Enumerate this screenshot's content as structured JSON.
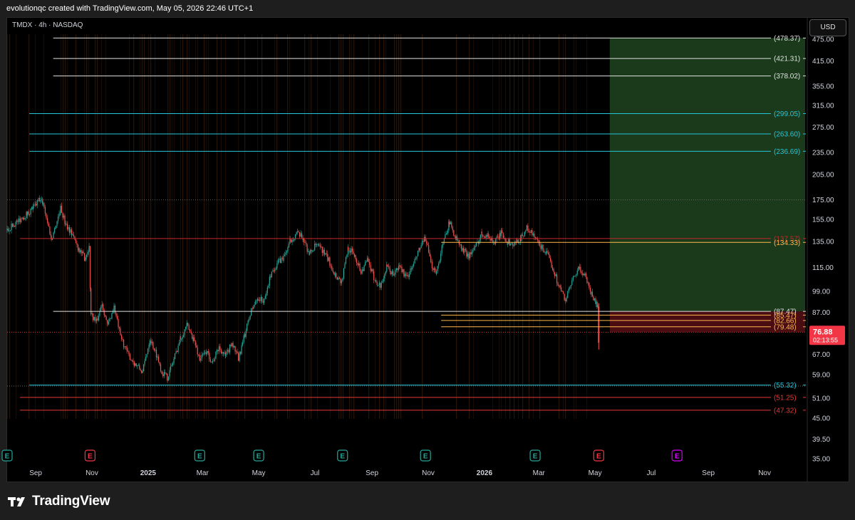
{
  "header": {
    "attribution": "evolutionqc created with TradingView.com, May 05, 2026 22:46 UTC+1"
  },
  "symbol": {
    "label": "TMDX · 4h · NASDAQ"
  },
  "currency": {
    "label": "USD"
  },
  "footer": {
    "brand": "TradingView"
  },
  "chart_data": {
    "type": "candlestick",
    "symbol": "TMDX",
    "interval": "4h",
    "exchange": "NASDAQ",
    "currency": "USD",
    "price_axis": {
      "scale": "log",
      "ticks": [
        475.0,
        415.0,
        355.0,
        315.0,
        275.0,
        235.0,
        205.0,
        175.0,
        155.0,
        135.0,
        115.0,
        99.0,
        87.0,
        76.88,
        67.0,
        59.0,
        51.0,
        45.0,
        39.5,
        35.0
      ]
    },
    "time_axis": {
      "start": "2024-08-01",
      "end": "2026-12-15",
      "labels": [
        {
          "date": "2024-09-01",
          "text": "Sep",
          "bold": false
        },
        {
          "date": "2024-11-01",
          "text": "Nov",
          "bold": false
        },
        {
          "date": "2025-01-01",
          "text": "2025",
          "bold": true
        },
        {
          "date": "2025-03-01",
          "text": "Mar",
          "bold": false
        },
        {
          "date": "2025-05-01",
          "text": "May",
          "bold": false
        },
        {
          "date": "2025-07-01",
          "text": "Jul",
          "bold": false
        },
        {
          "date": "2025-09-01",
          "text": "Sep",
          "bold": false
        },
        {
          "date": "2025-11-01",
          "text": "Nov",
          "bold": false
        },
        {
          "date": "2026-01-01",
          "text": "2026",
          "bold": true
        },
        {
          "date": "2026-03-01",
          "text": "Mar",
          "bold": false
        },
        {
          "date": "2026-05-01",
          "text": "May",
          "bold": false
        },
        {
          "date": "2026-07-01",
          "text": "Jul",
          "bold": false
        },
        {
          "date": "2026-09-01",
          "text": "Sep",
          "bold": false
        },
        {
          "date": "2026-11-01",
          "text": "Nov",
          "bold": false
        }
      ]
    },
    "price_path": [
      [
        "2024-08-01",
        145
      ],
      [
        "2024-08-08",
        150
      ],
      [
        "2024-08-15",
        155
      ],
      [
        "2024-08-22",
        160
      ],
      [
        "2024-08-29",
        166
      ],
      [
        "2024-09-05",
        175
      ],
      [
        "2024-09-09",
        172
      ],
      [
        "2024-09-14",
        152
      ],
      [
        "2024-09-18",
        137
      ],
      [
        "2024-09-23",
        150
      ],
      [
        "2024-09-28",
        166
      ],
      [
        "2024-10-03",
        152
      ],
      [
        "2024-10-10",
        142
      ],
      [
        "2024-10-17",
        130
      ],
      [
        "2024-10-24",
        122
      ],
      [
        "2024-10-29",
        130
      ],
      [
        "2024-10-31",
        86
      ],
      [
        "2024-11-06",
        82
      ],
      [
        "2024-11-12",
        92
      ],
      [
        "2024-11-18",
        80
      ],
      [
        "2024-11-25",
        90
      ],
      [
        "2024-12-02",
        75
      ],
      [
        "2024-12-10",
        67
      ],
      [
        "2024-12-18",
        63
      ],
      [
        "2024-12-26",
        60
      ],
      [
        "2025-01-03",
        74
      ],
      [
        "2025-01-10",
        67
      ],
      [
        "2025-01-16",
        60
      ],
      [
        "2025-01-22",
        58
      ],
      [
        "2025-01-29",
        65
      ],
      [
        "2025-02-05",
        74
      ],
      [
        "2025-02-12",
        80
      ],
      [
        "2025-02-19",
        74
      ],
      [
        "2025-02-26",
        65
      ],
      [
        "2025-03-05",
        68
      ],
      [
        "2025-03-12",
        64
      ],
      [
        "2025-03-19",
        70
      ],
      [
        "2025-03-26",
        66
      ],
      [
        "2025-04-02",
        72
      ],
      [
        "2025-04-09",
        65
      ],
      [
        "2025-04-16",
        76
      ],
      [
        "2025-04-23",
        88
      ],
      [
        "2025-04-30",
        95
      ],
      [
        "2025-05-07",
        93
      ],
      [
        "2025-05-14",
        110
      ],
      [
        "2025-05-21",
        118
      ],
      [
        "2025-05-28",
        122
      ],
      [
        "2025-06-04",
        135
      ],
      [
        "2025-06-11",
        142
      ],
      [
        "2025-06-18",
        138
      ],
      [
        "2025-06-25",
        125
      ],
      [
        "2025-07-02",
        132
      ],
      [
        "2025-07-09",
        128
      ],
      [
        "2025-07-16",
        120
      ],
      [
        "2025-07-23",
        110
      ],
      [
        "2025-07-30",
        105
      ],
      [
        "2025-08-06",
        130
      ],
      [
        "2025-08-13",
        124
      ],
      [
        "2025-08-20",
        112
      ],
      [
        "2025-08-27",
        120
      ],
      [
        "2025-09-03",
        108
      ],
      [
        "2025-09-10",
        102
      ],
      [
        "2025-09-17",
        115
      ],
      [
        "2025-09-24",
        110
      ],
      [
        "2025-10-01",
        116
      ],
      [
        "2025-10-08",
        108
      ],
      [
        "2025-10-15",
        115
      ],
      [
        "2025-10-22",
        128
      ],
      [
        "2025-10-29",
        138
      ],
      [
        "2025-11-04",
        117
      ],
      [
        "2025-11-10",
        112
      ],
      [
        "2025-11-16",
        130
      ],
      [
        "2025-11-21",
        145
      ],
      [
        "2025-11-24",
        152
      ],
      [
        "2025-12-01",
        138
      ],
      [
        "2025-12-08",
        128
      ],
      [
        "2025-12-15",
        124
      ],
      [
        "2025-12-22",
        130
      ],
      [
        "2025-12-29",
        142
      ],
      [
        "2026-01-05",
        140
      ],
      [
        "2026-01-12",
        134
      ],
      [
        "2026-01-19",
        142
      ],
      [
        "2026-01-26",
        135
      ],
      [
        "2026-02-02",
        132
      ],
      [
        "2026-02-09",
        138
      ],
      [
        "2026-02-16",
        147
      ],
      [
        "2026-02-23",
        140
      ],
      [
        "2026-03-02",
        132
      ],
      [
        "2026-03-09",
        126
      ],
      [
        "2026-03-16",
        115
      ],
      [
        "2026-03-23",
        102
      ],
      [
        "2026-03-30",
        94
      ],
      [
        "2026-04-06",
        105
      ],
      [
        "2026-04-13",
        114
      ],
      [
        "2026-04-20",
        110
      ],
      [
        "2026-04-27",
        98
      ],
      [
        "2026-05-02",
        92
      ],
      [
        "2026-05-04",
        90
      ],
      [
        "2026-05-05",
        76.88
      ]
    ],
    "projection_box": {
      "start": "2026-05-17",
      "end": "2026-12-15",
      "target_top": 478.37,
      "entry": 87.47,
      "stop": 76.88,
      "target_color": "#1b3a1c",
      "stop_color": "#4a0e12"
    },
    "levels": [
      {
        "price": 478.37,
        "label": "(478.37)",
        "color": "#e0e0e0",
        "start": "2024-09-20"
      },
      {
        "price": 421.31,
        "label": "(421.31)",
        "color": "#e0e0e0",
        "start": "2024-09-20"
      },
      {
        "price": 378.02,
        "label": "(378.02)",
        "color": "#e0e0e0",
        "start": "2024-09-20"
      },
      {
        "price": 299.05,
        "label": "(299.05)",
        "color": "#26c6da",
        "start": "2024-08-25"
      },
      {
        "price": 263.6,
        "label": "(263.60)",
        "color": "#26c6da",
        "start": "2024-08-25"
      },
      {
        "price": 236.69,
        "label": "(236.69)",
        "color": "#26c6da",
        "start": "2024-08-25"
      },
      {
        "price": 137.57,
        "label": "(137.57)",
        "color": "#c62828",
        "start": "2024-08-15"
      },
      {
        "price": 134.33,
        "label": "(134.33)",
        "color": "#ffb74d",
        "start": "2025-11-15"
      },
      {
        "price": 87.47,
        "label": "(87.47)",
        "color": "#e0e0e0",
        "start": "2024-09-20"
      },
      {
        "price": 85.47,
        "label": "(85.47)",
        "color": "#ffb74d",
        "start": "2025-11-15"
      },
      {
        "price": 82.66,
        "label": "(82.66)",
        "color": "#ffb74d",
        "start": "2025-11-15"
      },
      {
        "price": 79.48,
        "label": "(79.48)",
        "color": "#ffb74d",
        "start": "2025-11-15"
      },
      {
        "price": 55.32,
        "label": "(55.32)",
        "color": "#26c6da",
        "start": "2024-08-25"
      },
      {
        "price": 51.25,
        "label": "(51.25)",
        "color": "#e53935",
        "start": "2024-08-15"
      },
      {
        "price": 47.32,
        "label": "(47.32)",
        "color": "#e53935",
        "start": "2024-08-15"
      }
    ],
    "dotted_levels": [
      175.0,
      76.88,
      55.0
    ],
    "last_price": {
      "value": "76.88",
      "countdown": "02:13:55",
      "color": "#f23645"
    },
    "earnings_markers": [
      {
        "date": "2024-08-01",
        "color": "#26a69a",
        "label": "E"
      },
      {
        "date": "2024-10-30",
        "color": "#f23645",
        "label": "E"
      },
      {
        "date": "2025-02-26",
        "color": "#26a69a",
        "label": "E"
      },
      {
        "date": "2025-05-01",
        "color": "#26a69a",
        "label": "E"
      },
      {
        "date": "2025-07-31",
        "color": "#26a69a",
        "label": "E"
      },
      {
        "date": "2025-10-29",
        "color": "#26a69a",
        "label": "E"
      },
      {
        "date": "2026-02-25",
        "color": "#26a69a",
        "label": "E"
      },
      {
        "date": "2026-05-05",
        "color": "#f23645",
        "label": "E"
      },
      {
        "date": "2026-07-29",
        "color": "#d500f9",
        "label": "E"
      }
    ]
  }
}
